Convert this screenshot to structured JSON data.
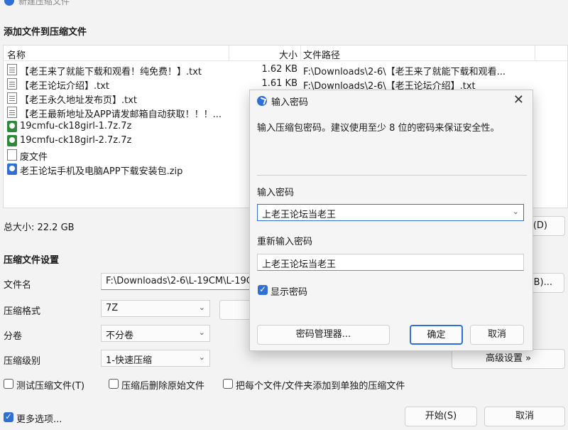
{
  "window": {
    "title": "新建压缩文件"
  },
  "add_section": {
    "title": "添加文件到压缩文件"
  },
  "filelist": {
    "columns": {
      "name": "名称",
      "size": "大小",
      "path": "文件路径"
    },
    "rows": [
      {
        "icon": "text-file-icon",
        "name": "【老王来了就能下载和观看！纯免费！】.txt",
        "size": "1.62 KB",
        "path": "F:\\Downloads\\2-6\\【老王来了就能下载和观看..."
      },
      {
        "icon": "text-file-icon",
        "name": "【老王论坛介绍】.txt",
        "size": "1.61 KB",
        "path": "F:\\Downloads\\2-6\\【老王论坛介绍】.txt"
      },
      {
        "icon": "text-file-icon",
        "name": "【老王永久地址发布页】.txt",
        "size": "",
        "path": ""
      },
      {
        "icon": "text-file-icon",
        "name": "【老王最新地址及APP请发邮箱自动获取！！！...",
        "size": "",
        "path": ""
      },
      {
        "icon": "archive-icon",
        "name": "19cmfu-ck18girl-1.7z.7z",
        "size": "",
        "path": ""
      },
      {
        "icon": "archive-icon",
        "name": "19cmfu-ck18girl-2.7z.7z",
        "size": "",
        "path": ""
      },
      {
        "icon": "blank-file-icon",
        "name": "废文件",
        "size": "",
        "path": ""
      },
      {
        "icon": "zip-icon",
        "name": "老王论坛手机及电脑APP下载安装包.zip",
        "size": "",
        "path": ""
      }
    ]
  },
  "total": {
    "label": "总大小: 22.2 GB",
    "partial_button": "(D)"
  },
  "settings": {
    "title": "压缩文件设置",
    "filename_label": "文件名",
    "filename_value": "F:\\Downloads\\2-6\\L-19CM\\L-19C",
    "browse_button_partial": "B)...",
    "format_label": "压缩格式",
    "format_value": "7Z",
    "split_label": "分卷",
    "split_value": "不分卷",
    "level_label": "压缩级别",
    "level_value": "1-快速压缩",
    "advanced_button": "高级设置 »"
  },
  "options": {
    "test": "测试压缩文件(T)",
    "delete_after": "压缩后删除原始文件",
    "separate": "把每个文件/文件夹添加到单独的压缩文件",
    "more": "更多选项..."
  },
  "footer": {
    "start": "开始(S)",
    "cancel": "取消"
  },
  "dialog": {
    "title": "输入密码",
    "close": "✕",
    "description": "输入压缩包密码。建议使用至少 8 位的密码来保证安全性。",
    "password_label": "输入密码",
    "password_value": "上老王论坛当老王",
    "confirm_label": "重新输入密码",
    "confirm_value": "上老王论坛当老王",
    "show_password": "显示密码",
    "manager_button": "密码管理器...",
    "ok_button": "确定",
    "cancel_button": "取消"
  },
  "colors": {
    "accent": "#2f6fd6",
    "archive": "#2c8a3a"
  }
}
